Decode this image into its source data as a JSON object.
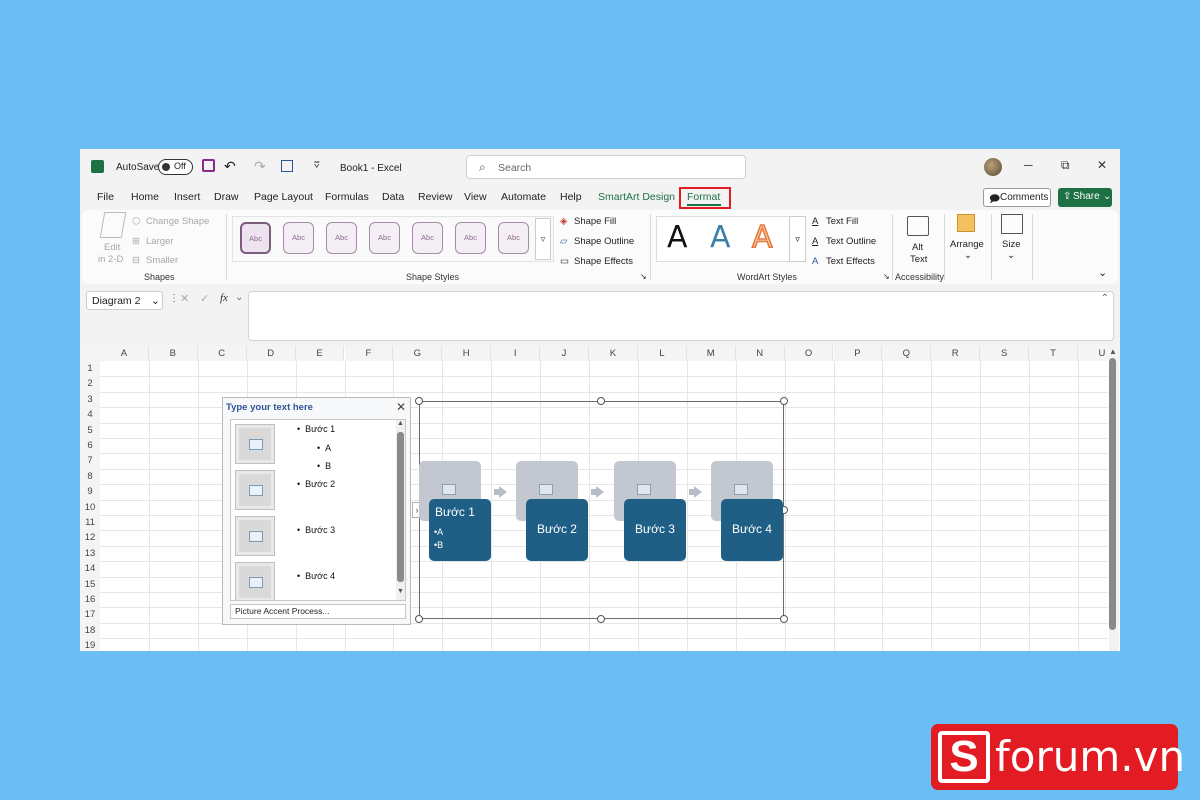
{
  "titlebar": {
    "autosave_label": "AutoSave",
    "autosave_state": "Off",
    "doc_title": "Book1",
    "app_name": "Excel",
    "search_placeholder": "Search",
    "minimize": "─",
    "restore": "⧉",
    "close": "✕"
  },
  "tabs": [
    "File",
    "Home",
    "Insert",
    "Draw",
    "Page Layout",
    "Formulas",
    "Data",
    "Review",
    "View",
    "Automate",
    "Help",
    "SmartArt Design",
    "Format"
  ],
  "header_buttons": {
    "comments": "Comments",
    "share": "Share"
  },
  "ribbon": {
    "shapes": {
      "edit_2d_line1": "Edit",
      "edit_2d_line2": "in 2-D",
      "change_shape": "Change Shape",
      "larger": "Larger",
      "smaller": "Smaller",
      "group_label": "Shapes"
    },
    "shape_styles": {
      "sample": "Abc",
      "fill": "Shape Fill",
      "outline": "Shape Outline",
      "effects": "Shape Effects",
      "group_label": "Shape Styles"
    },
    "wordart": {
      "letter": "A",
      "text_fill": "Text Fill",
      "text_outline": "Text Outline",
      "text_effects": "Text Effects",
      "group_label": "WordArt Styles"
    },
    "accessibility": {
      "alt_line1": "Alt",
      "alt_line2": "Text",
      "group_label": "Accessibility"
    },
    "arrange": "Arrange",
    "size": "Size"
  },
  "formula_bar": {
    "name_box": "Diagram 2",
    "fx": "fx"
  },
  "grid": {
    "columns": [
      "A",
      "B",
      "C",
      "D",
      "E",
      "F",
      "G",
      "H",
      "I",
      "J",
      "K",
      "L",
      "M",
      "N",
      "O",
      "P",
      "Q",
      "R",
      "S",
      "T",
      "U"
    ],
    "rows": [
      "1",
      "2",
      "3",
      "4",
      "5",
      "6",
      "7",
      "8",
      "9",
      "10",
      "11",
      "12",
      "13",
      "14",
      "15",
      "16",
      "17",
      "18",
      "19"
    ]
  },
  "text_pane": {
    "title": "Type your text here",
    "close": "✕",
    "items": [
      {
        "text": "Bước 1",
        "level": 1
      },
      {
        "text": "A",
        "level": 2
      },
      {
        "text": "B",
        "level": 2
      },
      {
        "text": "Bước 2",
        "level": 1
      },
      {
        "text": "Bước 3",
        "level": 1
      },
      {
        "text": "Bước 4",
        "level": 1
      }
    ],
    "footer": "Picture Accent Process..."
  },
  "diagram": {
    "steps": [
      {
        "label": "Bước 1",
        "sub": [
          "•A",
          "•B"
        ]
      },
      {
        "label": "Bước 2"
      },
      {
        "label": "Bước 3"
      },
      {
        "label": "Bước 4"
      }
    ]
  },
  "watermark": {
    "mark": "S",
    "text": "forum.vn"
  },
  "colors": {
    "background": "#6bbef3",
    "excel_green": "#1e7145",
    "step_blue": "#1f5f86",
    "highlight_red": "#e31b23"
  }
}
